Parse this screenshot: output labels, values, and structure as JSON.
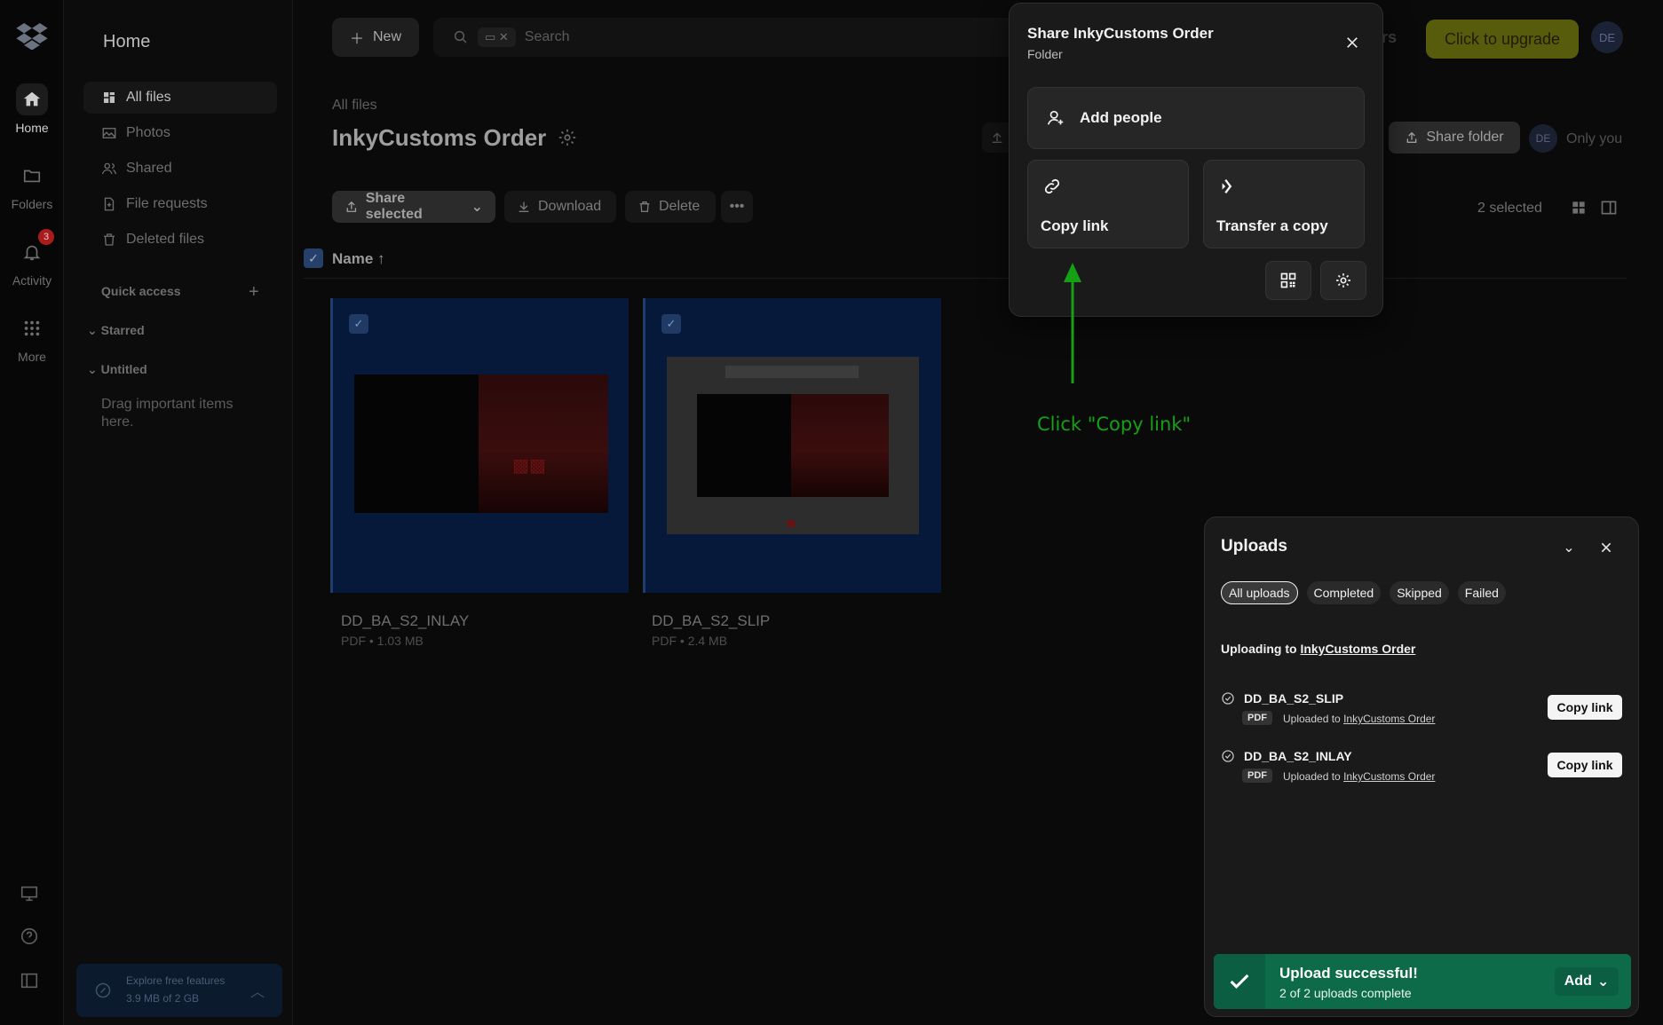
{
  "rail": {
    "items": [
      {
        "label": "Home"
      },
      {
        "label": "Folders"
      },
      {
        "label": "Activity",
        "badge": "3"
      },
      {
        "label": "More"
      }
    ]
  },
  "sidebar": {
    "title": "Home",
    "nav": [
      "All files",
      "Photos",
      "Shared",
      "File requests",
      "Deleted files"
    ],
    "quick_access": "Quick access",
    "starred": "Starred",
    "untitled": "Untitled",
    "drag_hint": "Drag important items here.",
    "explore_title": "Explore free features",
    "explore_usage": "3.9 MB of 2 GB"
  },
  "topbar": {
    "new_label": "New",
    "search_placeholder": "Search",
    "ters_fragment": "ers",
    "upgrade_label": "Click to upgrade",
    "avatar_initials": "DE"
  },
  "main": {
    "breadcrumb": "All files",
    "title": "InkyCustoms Order",
    "actions": {
      "share_selected": "Share selected",
      "download": "Download",
      "delete": "Delete"
    },
    "share_folder": "Share folder",
    "avatar_initials": "DE",
    "only_you": "Only you",
    "selected_count": "2 selected",
    "column_name": "Name",
    "files": [
      {
        "name": "DD_BA_S2_INLAY",
        "meta": "PDF • 1.03 MB"
      },
      {
        "name": "DD_BA_S2_SLIP",
        "meta": "PDF • 2.4 MB"
      }
    ]
  },
  "share_popover": {
    "title": "Share InkyCustoms Order",
    "subtitle": "Folder",
    "add_people": "Add people",
    "copy_link": "Copy link",
    "transfer_copy": "Transfer a copy"
  },
  "annotation": {
    "text": "Click \"Copy link\"",
    "color": "#16a016"
  },
  "uploads": {
    "title": "Uploads",
    "filters": [
      "All uploads",
      "Completed",
      "Skipped",
      "Failed"
    ],
    "uploading_to_prefix": "Uploading to",
    "uploading_to_folder": "InkyCustoms Order",
    "items": [
      {
        "name": "DD_BA_S2_SLIP",
        "type": "PDF",
        "uploaded_prefix": "Uploaded to",
        "folder": "InkyCustoms Order",
        "action": "Copy link"
      },
      {
        "name": "DD_BA_S2_INLAY",
        "type": "PDF",
        "uploaded_prefix": "Uploaded to",
        "folder": "InkyCustoms Order",
        "action": "Copy link"
      }
    ],
    "toast": {
      "title": "Upload successful!",
      "subtitle": "2 of 2 uploads complete",
      "add_label": "Add"
    }
  }
}
